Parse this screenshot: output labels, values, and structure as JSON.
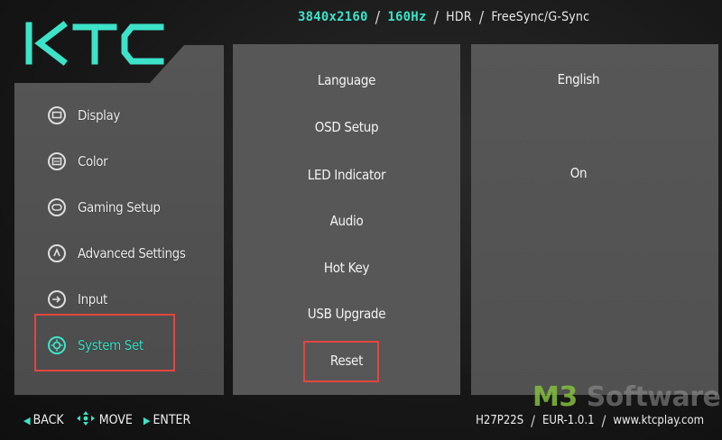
{
  "header": {
    "resolution": "3840x2160",
    "refresh": "160Hz",
    "hdr": "HDR",
    "sync": "FreeSync/G-Sync"
  },
  "logo": "KTC",
  "menu": {
    "items": [
      {
        "label": "Display",
        "icon": "display-icon"
      },
      {
        "label": "Color",
        "icon": "color-icon"
      },
      {
        "label": "Gaming Setup",
        "icon": "gaming-icon"
      },
      {
        "label": "Advanced Settings",
        "icon": "advanced-settings-icon"
      },
      {
        "label": "Input",
        "icon": "input-icon"
      },
      {
        "label": "System Set",
        "icon": "system-set-icon",
        "selected": true
      }
    ]
  },
  "submenu": {
    "items": [
      {
        "label": "Language",
        "value": "English"
      },
      {
        "label": "OSD Setup",
        "value": ""
      },
      {
        "label": "LED Indicator",
        "value": "On"
      },
      {
        "label": "Audio",
        "value": ""
      },
      {
        "label": "Hot Key",
        "value": ""
      },
      {
        "label": "USB Upgrade",
        "value": ""
      },
      {
        "label": "Reset",
        "value": ""
      }
    ]
  },
  "footer": {
    "back": "BACK",
    "move": "MOVE",
    "enter": "ENTER",
    "model": "H27P22S",
    "firmware": "EUR-1.0.1",
    "website": "www.ktcplay.com"
  },
  "watermark": {
    "prefix": "M3",
    "suffix": " Software"
  },
  "colors": {
    "accent": "#3de3c8",
    "highlight_box": "#e2463f",
    "panel": "#575757"
  }
}
